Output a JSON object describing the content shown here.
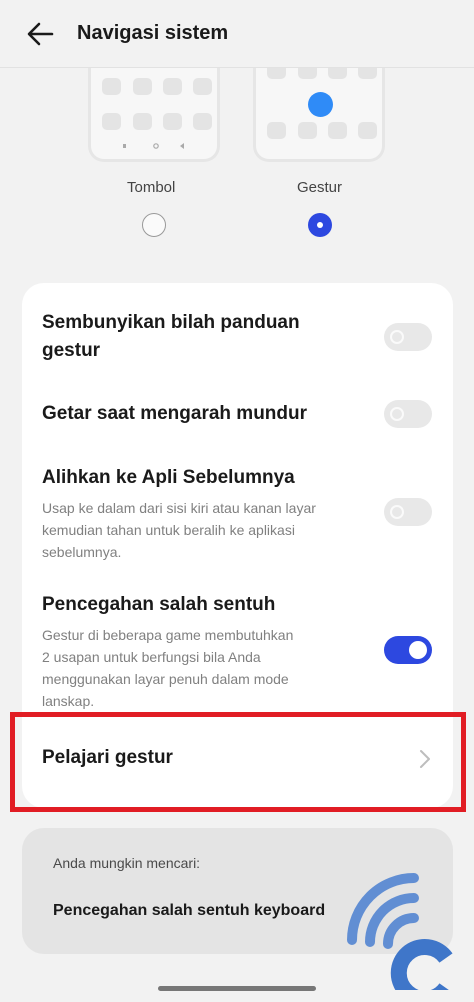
{
  "header": {
    "title": "Navigasi sistem",
    "back_icon": "arrow-left-icon"
  },
  "nav_modes": {
    "options": [
      {
        "label": "Tombol",
        "selected": false
      },
      {
        "label": "Gestur",
        "selected": true
      }
    ]
  },
  "settings": [
    {
      "title_lines": [
        "Sembunyikan bilah panduan",
        "gestur"
      ],
      "description": "",
      "enabled": false
    },
    {
      "title_lines": [
        "Getar saat mengarah mundur"
      ],
      "description": "",
      "enabled": false
    },
    {
      "title_lines": [
        "Alihkan ke Apli Sebelumnya"
      ],
      "description_lines": [
        "Usap ke dalam dari sisi kiri atau kanan layar",
        "kemudian tahan untuk beralih ke aplikasi",
        "sebelumnya."
      ],
      "enabled": false
    },
    {
      "title_lines": [
        "Pencegahan salah sentuh"
      ],
      "description_lines": [
        "Gestur di beberapa game membutuhkan",
        "2 usapan untuk berfungsi bila Anda",
        "menggunakan layar penuh dalam mode",
        "lanskap."
      ],
      "enabled": true
    }
  ],
  "learn": {
    "label": "Pelajari gestur",
    "icon": "chevron-right-icon"
  },
  "suggestions": {
    "heading": "Anda mungkin mencari:",
    "items": [
      "Pencegahan salah sentuh keyboard"
    ]
  },
  "colors": {
    "accent": "#2d48e0",
    "highlight": "#e11d24",
    "preview_dot": "#2f8bf7",
    "watermark": "#4a7fd0"
  }
}
